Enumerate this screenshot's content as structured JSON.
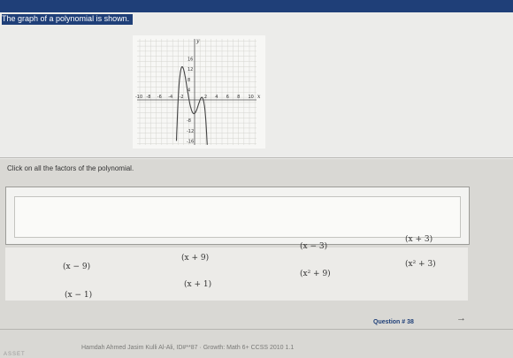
{
  "question": {
    "prompt": "The graph of a polynomial is shown."
  },
  "graph": {
    "axis_y_label": "y",
    "axis_x_label": "x",
    "x_ticks": [
      "-10",
      "-8",
      "-6",
      "-4",
      "-2",
      "2",
      "4",
      "6",
      "8",
      "10"
    ],
    "y_ticks": [
      "16",
      "12",
      "8",
      "4",
      "-8",
      "-12",
      "-16"
    ],
    "curve_color": "#444444"
  },
  "instruction": "Click on all the factors of the polynomial.",
  "choices": [
    {
      "label": "(x − 9)"
    },
    {
      "label": "(x + 9)"
    },
    {
      "label": "(x − 3)"
    },
    {
      "label": "(x + 3)"
    },
    {
      "label": "(x − 1)"
    },
    {
      "label": "(x + 1)"
    },
    {
      "label": "(x² + 9)"
    },
    {
      "label": "(x² + 3)"
    }
  ],
  "footer": {
    "credit": "Hamdah Ahmed Jasim Kulli Al-Ali, ID#**87 · Growth: Math 6+ CCSS 2010 1.1",
    "question_number": "Question # 38",
    "next_icon": "arrow-right-icon",
    "logo": "ASSET"
  },
  "colors": {
    "header_blue": "#1f3f78",
    "panel": "#ececea"
  }
}
